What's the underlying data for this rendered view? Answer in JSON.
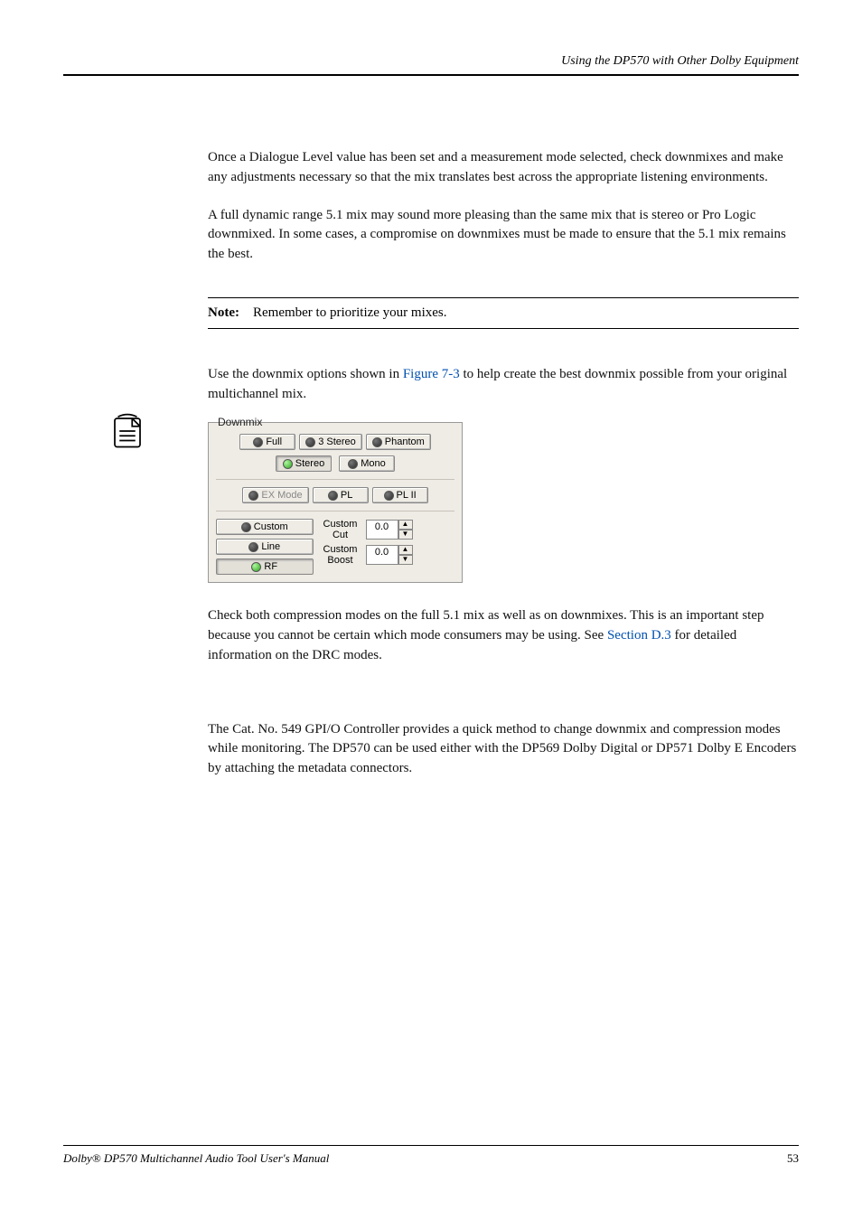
{
  "running_head": "Using the DP570 with Other Dolby Equipment",
  "paras": {
    "p1": "Once a Dialogue Level value has been set and a measurement mode selected, check downmixes and make any adjustments necessary so that the mix translates best across the appropriate listening environments.",
    "p2a": "A full dynamic range 5.1 mix may sound more pleasing than the same mix that is stereo or Pro Logic",
    "p2b": " downmixed. In some cases, a compromise on downmixes must be made to ensure that the 5.1 mix remains the best.",
    "p3a": "Use the downmix options shown in ",
    "p3link": "Figure 7-3",
    "p3b": " to help create the best downmix possible from your original multichannel mix.",
    "p4a": "Check both compression modes on the full 5.1 mix as well as on downmixes. This is an important step because you cannot be certain which mode consumers may be using. See ",
    "p4link": "Section D.3",
    "p4b": " for detailed information on the DRC modes.",
    "p5": "The Cat. No. 549 GPI/O Controller provides a quick method to change downmix and compression modes while monitoring. The DP570 can be used either with the DP569 Dolby Digital or DP571 Dolby E Encoders by attaching the metadata connectors."
  },
  "note": {
    "label": "Note:",
    "text": "Remember to prioritize your mixes."
  },
  "figure": {
    "legend": "Downmix",
    "row1": [
      "Full",
      "3 Stereo",
      "Phantom"
    ],
    "row2": [
      "Stereo",
      "Mono"
    ],
    "row3": [
      "EX Mode",
      "PL",
      "PL II"
    ],
    "col_left": [
      "Custom",
      "Line",
      "RF"
    ],
    "spins": [
      {
        "label_top": "Custom",
        "label_bottom": "Cut",
        "value": "0.0"
      },
      {
        "label_top": "Custom",
        "label_bottom": "Boost",
        "value": "0.0"
      }
    ]
  },
  "footer": {
    "left": "Dolby® DP570 Multichannel Audio Tool User's Manual",
    "page": "53"
  }
}
